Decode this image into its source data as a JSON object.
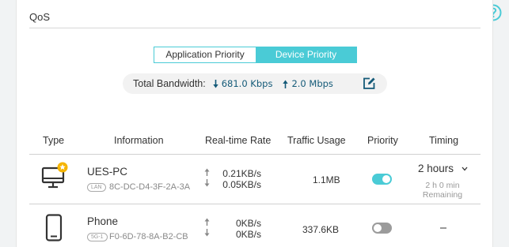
{
  "section": {
    "title": "QoS"
  },
  "tabs": [
    {
      "label": "Application Priority",
      "active": false
    },
    {
      "label": "Device Priority",
      "active": true
    }
  ],
  "bandwidth": {
    "label": "Total Bandwidth:",
    "download": "681.0 Kbps",
    "upload": "2.0 Mbps"
  },
  "table": {
    "headers": [
      "Type",
      "Information",
      "Real-time Rate",
      "Traffic Usage",
      "Priority",
      "Timing"
    ],
    "rows": [
      {
        "type_icon": "desktop-pc-icon",
        "starred": true,
        "name": "UES-PC",
        "connection": "LAN",
        "mac": "8C-DC-D4-3F-2A-3A",
        "rate_up": "0.21KB/s",
        "rate_down": "0.05KB/s",
        "usage": "1.1MB",
        "priority": true,
        "timing": "2 hours",
        "timing_remaining_time": "2 h 0 min",
        "timing_remaining_label": "Remaining"
      },
      {
        "type_icon": "phone-icon",
        "starred": false,
        "name": "Phone",
        "connection": "5G-1",
        "mac": "F0-6D-78-8A-B2-CB",
        "rate_up": "0KB/s",
        "rate_down": "0KB/s",
        "usage": "337.6KB",
        "priority": false,
        "timing": "-"
      }
    ]
  },
  "colors": {
    "accent": "#4acbd6",
    "bandwidth_value": "#145a78",
    "toggle_off": "#9b9b9b"
  }
}
